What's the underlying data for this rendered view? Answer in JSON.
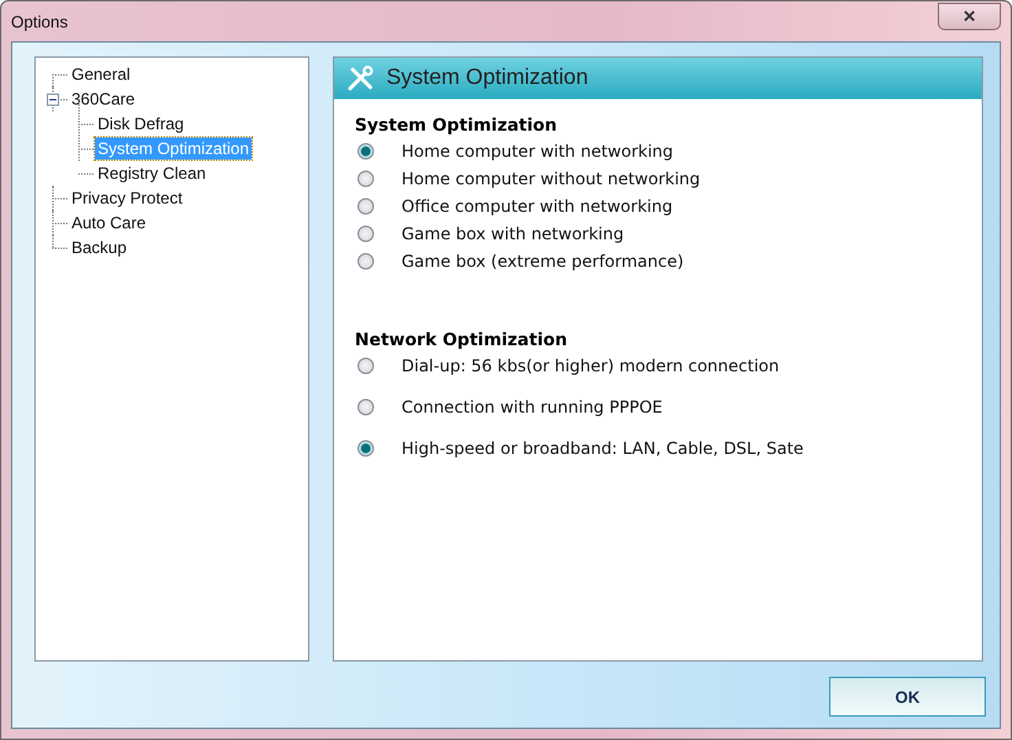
{
  "window": {
    "title": "Options",
    "close": "✕"
  },
  "tree": [
    {
      "label": "General",
      "selected": false
    },
    {
      "label": "360Care",
      "selected": false,
      "expanded": true,
      "children": [
        {
          "label": "Disk Defrag",
          "selected": false
        },
        {
          "label": "System Optimization",
          "selected": true
        },
        {
          "label": "Registry Clean",
          "selected": false
        }
      ]
    },
    {
      "label": "Privacy Protect",
      "selected": false
    },
    {
      "label": "Auto Care",
      "selected": false
    },
    {
      "label": "Backup",
      "selected": false
    }
  ],
  "panel": {
    "title": "System Optimization",
    "sections": [
      {
        "heading": "System Optimization",
        "options": [
          {
            "label": "Home computer with networking",
            "selected": true
          },
          {
            "label": "Home computer without networking",
            "selected": false
          },
          {
            "label": "Office computer with networking",
            "selected": false
          },
          {
            "label": "Game box with networking",
            "selected": false
          },
          {
            "label": "Game box (extreme performance)",
            "selected": false
          }
        ]
      },
      {
        "heading": "Network Optimization",
        "options": [
          {
            "label": "Dial-up: 56 kbs(or higher) modern connection",
            "selected": false
          },
          {
            "label": "Connection with running PPPOE",
            "selected": false
          },
          {
            "label": "High-speed or broadband: LAN, Cable, DSL, Sate",
            "selected": true
          }
        ]
      }
    ]
  },
  "buttons": [
    "OK"
  ]
}
